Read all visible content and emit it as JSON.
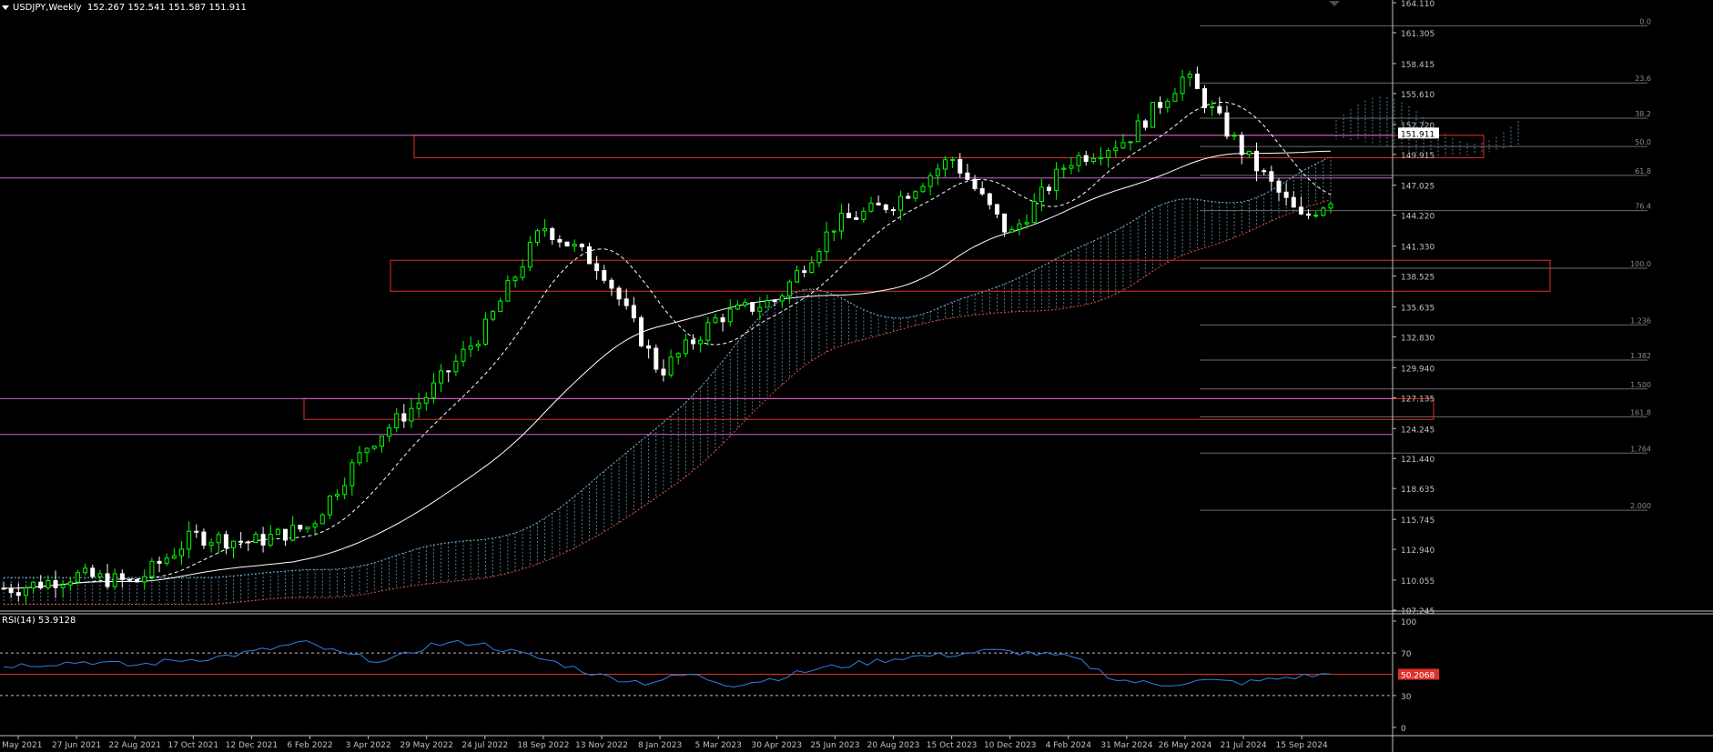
{
  "header": {
    "symbol": "USDJPY,Weekly",
    "ohlc": "152.267 152.541 151.587 151.911"
  },
  "rsi": {
    "label": "RSI(14) 53.9128",
    "current_marker": "50.2068",
    "axis_ticks": [
      "100",
      "70",
      "30",
      "0"
    ]
  },
  "price_axis": {
    "ticks": [
      "164.110",
      "161.305",
      "158.415",
      "155.610",
      "152.720",
      "149.915",
      "147.025",
      "144.220",
      "141.330",
      "138.525",
      "135.635",
      "132.830",
      "129.940",
      "127.135",
      "124.245",
      "121.440",
      "118.635",
      "115.745",
      "112.940",
      "110.055",
      "107.245"
    ],
    "current_price": "151.911"
  },
  "time_axis": {
    "labels": [
      "2 May 2021",
      "27 Jun 2021",
      "22 Aug 2021",
      "17 Oct 2021",
      "12 Dec 2021",
      "6 Feb 2022",
      "3 Apr 2022",
      "29 May 2022",
      "24 Jul 2022",
      "18 Sep 2022",
      "13 Nov 2022",
      "8 Jan 2023",
      "5 Mar 2023",
      "30 Apr 2023",
      "25 Jun 2023",
      "20 Aug 2023",
      "15 Oct 2023",
      "10 Dec 2023",
      "4 Feb 2024",
      "31 Mar 2024",
      "26 May 2024",
      "21 Jul 2024",
      "15 Sep 2024"
    ]
  },
  "fibonacci": {
    "levels": [
      {
        "label": "0.0",
        "price": 161.95
      },
      {
        "label": "23.6",
        "price": 156.6
      },
      {
        "label": "38.2",
        "price": 153.3
      },
      {
        "label": "50.0",
        "price": 150.65
      },
      {
        "label": "61.8",
        "price": 147.95
      },
      {
        "label": "76.4",
        "price": 144.65
      },
      {
        "label": "100.0",
        "price": 139.25
      },
      {
        "label": "1.236",
        "price": 133.95
      },
      {
        "label": "1.382",
        "price": 130.65
      },
      {
        "label": "1.500",
        "price": 127.95
      },
      {
        "label": "161.8",
        "price": 125.35
      },
      {
        "label": "1.764",
        "price": 121.95
      },
      {
        "label": "2.000",
        "price": 116.6
      }
    ]
  },
  "colors": {
    "background": "#000000",
    "bull_candle": "#00ff00",
    "bear_candle": "#ffffff",
    "ma_slow": "#ffffff",
    "ma_fast": "#ffffff",
    "kumo_bull": "#6fb7d9",
    "kumo_bear": "#e0503c",
    "zone": "#e0302a",
    "horizontal": "#cc66cc",
    "fib": "#6b6b6b",
    "rsi_line": "#2f7fe0",
    "rsi_level": "#e0302a",
    "axis": "#c0c0c0"
  },
  "chart_data": {
    "type": "candlestick",
    "symbol": "USDJPY",
    "timeframe": "Weekly",
    "ylim": [
      107.245,
      164.11
    ],
    "x": [
      "2 May 2021",
      "27 Jun 2021",
      "22 Aug 2021",
      "17 Oct 2021",
      "12 Dec 2021",
      "6 Feb 2022",
      "3 Apr 2022",
      "29 May 2022",
      "24 Jul 2022",
      "18 Sep 2022",
      "13 Nov 2022",
      "8 Jan 2023",
      "5 Mar 2023",
      "30 Apr 2023",
      "25 Jun 2023",
      "20 Aug 2023",
      "15 Oct 2023",
      "10 Dec 2023",
      "4 Feb 2024",
      "31 Mar 2024",
      "26 May 2024",
      "21 Jul 2024",
      "15 Sep 2024"
    ],
    "close": [
      109.3,
      110.5,
      109.8,
      114.2,
      113.6,
      115.1,
      122.8,
      127.3,
      133.6,
      143.2,
      139.3,
      129.5,
      134.7,
      136.3,
      143.4,
      145.4,
      149.6,
      142.3,
      149.3,
      151.3,
      157.3,
      150.1,
      143.8
    ],
    "close_last": 151.911,
    "horizontal_lines": [
      151.7,
      147.7,
      127.05,
      123.7
    ],
    "zones": [
      {
        "top": 151.7,
        "bottom": 149.6
      },
      {
        "top": 140.0,
        "bottom": 137.1
      },
      {
        "top": 127.05,
        "bottom": 125.1
      }
    ],
    "indicator": {
      "name": "RSI(14)",
      "ylim": [
        0,
        100
      ],
      "levels": [
        70,
        50,
        30
      ],
      "last_value": 53.9128,
      "values": [
        58,
        60,
        62,
        58,
        63,
        66,
        72,
        80,
        68,
        62,
        78,
        80,
        70,
        60,
        48,
        42,
        50,
        40,
        46,
        55,
        60,
        66,
        68,
        72,
        70,
        65,
        45,
        40,
        44,
        42,
        47,
        50
      ]
    }
  }
}
